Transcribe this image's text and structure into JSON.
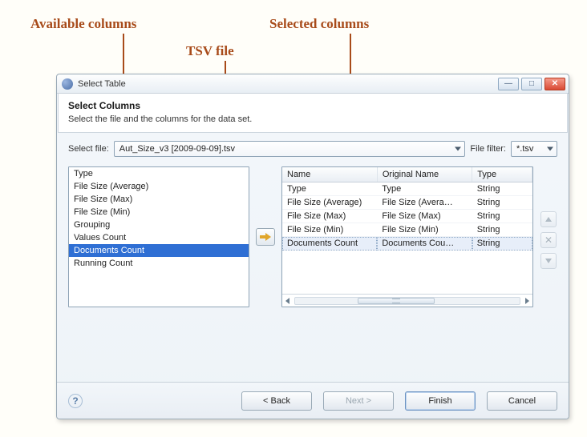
{
  "callouts": {
    "available": "Available columns",
    "tsv": "TSV file",
    "selected": "Selected columns"
  },
  "dialog": {
    "window_title": "Select Table",
    "heading": "Select Columns",
    "description": "Select the file and the columns for the data set."
  },
  "file_row": {
    "label": "Select file:",
    "value": "Aut_Size_v3 [2009-09-09].tsv",
    "filter_label": "File filter:",
    "filter_value": "*.tsv"
  },
  "available": {
    "items": [
      {
        "label": "Type",
        "selected": false
      },
      {
        "label": "File Size (Average)",
        "selected": false
      },
      {
        "label": "File Size (Max)",
        "selected": false
      },
      {
        "label": "File Size (Min)",
        "selected": false
      },
      {
        "label": "Grouping",
        "selected": false
      },
      {
        "label": "Values Count",
        "selected": false
      },
      {
        "label": "Documents Count",
        "selected": true
      },
      {
        "label": "Running Count",
        "selected": false
      }
    ]
  },
  "selected_table": {
    "headers": {
      "name": "Name",
      "original": "Original Name",
      "type": "Type"
    },
    "rows": [
      {
        "name": "Type",
        "original": "Type",
        "type": "String",
        "sel": false
      },
      {
        "name": "File Size (Average)",
        "original": "File Size (Avera…",
        "type": "String",
        "sel": false
      },
      {
        "name": "File Size (Max)",
        "original": "File Size (Max)",
        "type": "String",
        "sel": false
      },
      {
        "name": "File Size (Min)",
        "original": "File Size (Min)",
        "type": "String",
        "sel": false
      },
      {
        "name": "Documents Count",
        "original": "Documents Cou…",
        "type": "String",
        "sel": true
      }
    ]
  },
  "buttons": {
    "back": "< Back",
    "next": "Next >",
    "finish": "Finish",
    "cancel": "Cancel",
    "help": "?"
  }
}
